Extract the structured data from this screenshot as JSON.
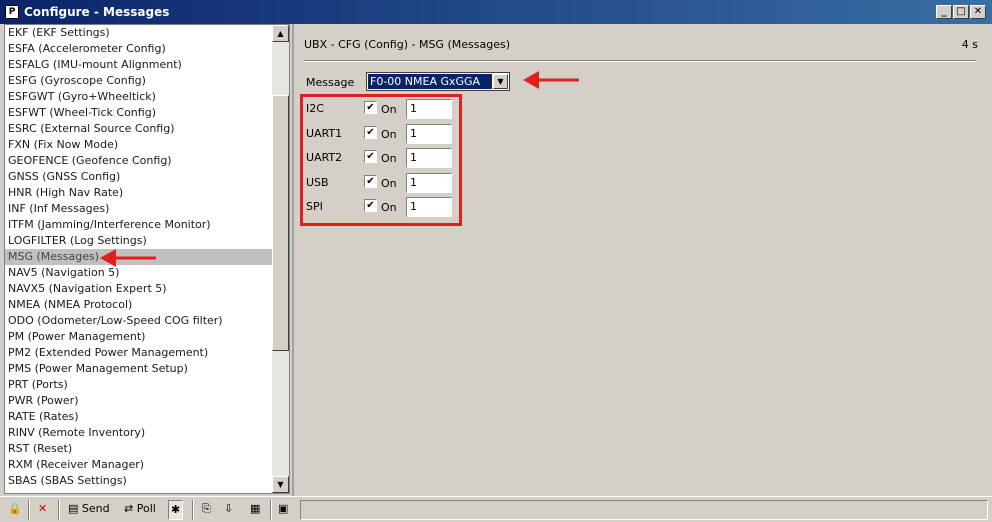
{
  "window": {
    "title": "Configure - Messages",
    "app_icon_letter": "P",
    "minimize_glyph": "_",
    "maximize_glyph": "□",
    "close_glyph": "✕"
  },
  "config_list": {
    "items": [
      "EKF (EKF Settings)",
      "ESFA (Accelerometer Config)",
      "ESFALG (IMU-mount Alignment)",
      "ESFG (Gyroscope Config)",
      "ESFGWT (Gyro+Wheeltick)",
      "ESFWT (Wheel-Tick Config)",
      "ESRC (External Source Config)",
      "FXN (Fix Now Mode)",
      "GEOFENCE (Geofence Config)",
      "GNSS (GNSS Config)",
      "HNR (High Nav Rate)",
      "INF (Inf Messages)",
      "ITFM (Jamming/Interference Monitor)",
      "LOGFILTER (Log Settings)",
      "MSG (Messages)",
      "NAV5 (Navigation 5)",
      "NAVX5 (Navigation Expert 5)",
      "NMEA (NMEA Protocol)",
      "ODO (Odometer/Low-Speed COG filter)",
      "PM (Power Management)",
      "PM2 (Extended Power Management)",
      "PMS (Power Management Setup)",
      "PRT (Ports)",
      "PWR (Power)",
      "RATE (Rates)",
      "RINV (Remote Inventory)",
      "RST (Reset)",
      "RXM (Receiver Manager)",
      "SBAS (SBAS Settings)"
    ],
    "selected_item": "MSG (Messages)"
  },
  "panel": {
    "title": "UBX - CFG (Config) - MSG (Messages)",
    "time": "4 s",
    "message_label": "Message",
    "message_selected": "F0-00 NMEA GxGGA",
    "on_label": "On",
    "ports": [
      {
        "name": "I2C",
        "enabled": true,
        "rate": "1"
      },
      {
        "name": "UART1",
        "enabled": true,
        "rate": "1"
      },
      {
        "name": "UART2",
        "enabled": true,
        "rate": "1"
      },
      {
        "name": "USB",
        "enabled": true,
        "rate": "1"
      },
      {
        "name": "SPI",
        "enabled": true,
        "rate": "1"
      }
    ]
  },
  "annotation": {
    "color": "#e02020"
  },
  "toolbar": {
    "lock_icon": "🔒",
    "cancel_icon": "✕",
    "send_label": "Send",
    "poll_label": "Poll",
    "send_icon": "▤",
    "poll_icon": "⇄",
    "pin_icon": "✱",
    "copy_icon": "⎘",
    "paste_icon": "⇩",
    "list_icon": "▦",
    "export_icon": "▣"
  }
}
